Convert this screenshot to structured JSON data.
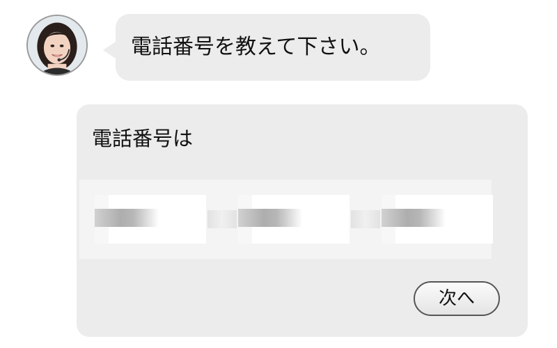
{
  "chat": {
    "message": "電話番号を教えて下さい。"
  },
  "form": {
    "label": "電話番号は",
    "phone_fields": [
      "",
      "",
      ""
    ],
    "next_button_label": "次へ"
  },
  "avatar": {
    "icon": "operator-headset-avatar"
  }
}
